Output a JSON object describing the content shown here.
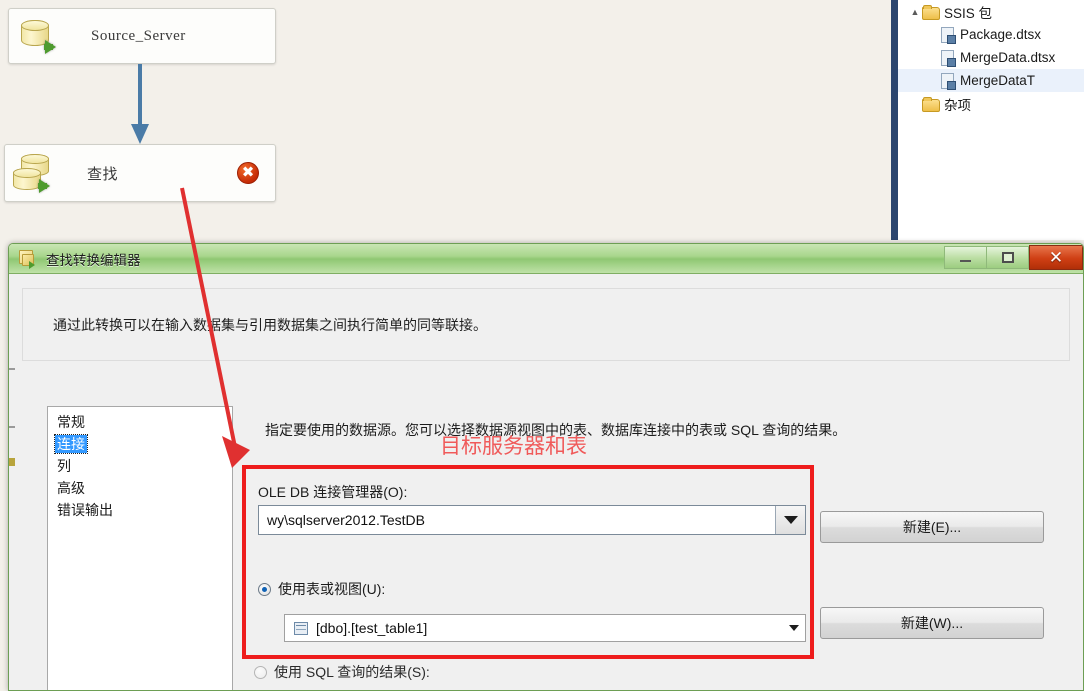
{
  "canvas": {
    "nodes": [
      {
        "label": "Source_Server",
        "icon": "database-source-icon",
        "has_error": false
      },
      {
        "label": "查找",
        "icon": "lookup-transform-icon",
        "has_error": true,
        "error_glyph": "✖"
      }
    ],
    "connector": "data-flow-path-arrow"
  },
  "explorer": {
    "rows": [
      {
        "text": "SSIS 包",
        "kind": "folder",
        "indent": 1,
        "twisty": "▲",
        "selected": false
      },
      {
        "text": "Package.dtsx",
        "kind": "file",
        "indent": 2,
        "twisty": "",
        "selected": false
      },
      {
        "text": "MergeData.dtsx",
        "kind": "file",
        "indent": 2,
        "twisty": "",
        "selected": false
      },
      {
        "text": "MergeDataT",
        "kind": "file",
        "indent": 2,
        "twisty": "",
        "selected": true
      },
      {
        "text": "杂项",
        "kind": "folder",
        "indent": 1,
        "twisty": "",
        "selected": false
      }
    ]
  },
  "dialog": {
    "title": "查找转换编辑器",
    "title_icon": "lookup-transform-icon",
    "window_buttons": {
      "minimize": "minimize-icon",
      "restore": "restore-icon",
      "close": "✕"
    },
    "description": "通过此转换可以在输入数据集与引用数据集之间执行简单的同等联接。",
    "pages": [
      {
        "label": "常规",
        "selected": false
      },
      {
        "label": "连接",
        "selected": true
      },
      {
        "label": "列",
        "selected": false
      },
      {
        "label": "高级",
        "selected": false
      },
      {
        "label": "错误输出",
        "selected": false
      }
    ],
    "instruction": "指定要使用的数据源。您可以选择数据源视图中的表、数据库连接中的表或 SQL 查询的结果。",
    "connection_group": {
      "oledb_label": "OLE DB 连接管理器(O):",
      "oledb_value": "wy\\sqlserver2012.TestDB",
      "radio_table_label": "使用表或视图(U):",
      "radio_table_selected": true,
      "table_value": "[dbo].[test_table1]",
      "table_icon": "table-icon",
      "radio_sql_label": "使用 SQL 查询的结果(S):",
      "radio_sql_selected": false
    },
    "buttons": {
      "new_connection": "新建(E)...",
      "new_table": "新建(W)..."
    }
  },
  "annotation": {
    "label": "目标服务器和表",
    "label_color": "#f05a5a",
    "box_color": "#ee1c1c",
    "arrow_color": "#e03030"
  }
}
